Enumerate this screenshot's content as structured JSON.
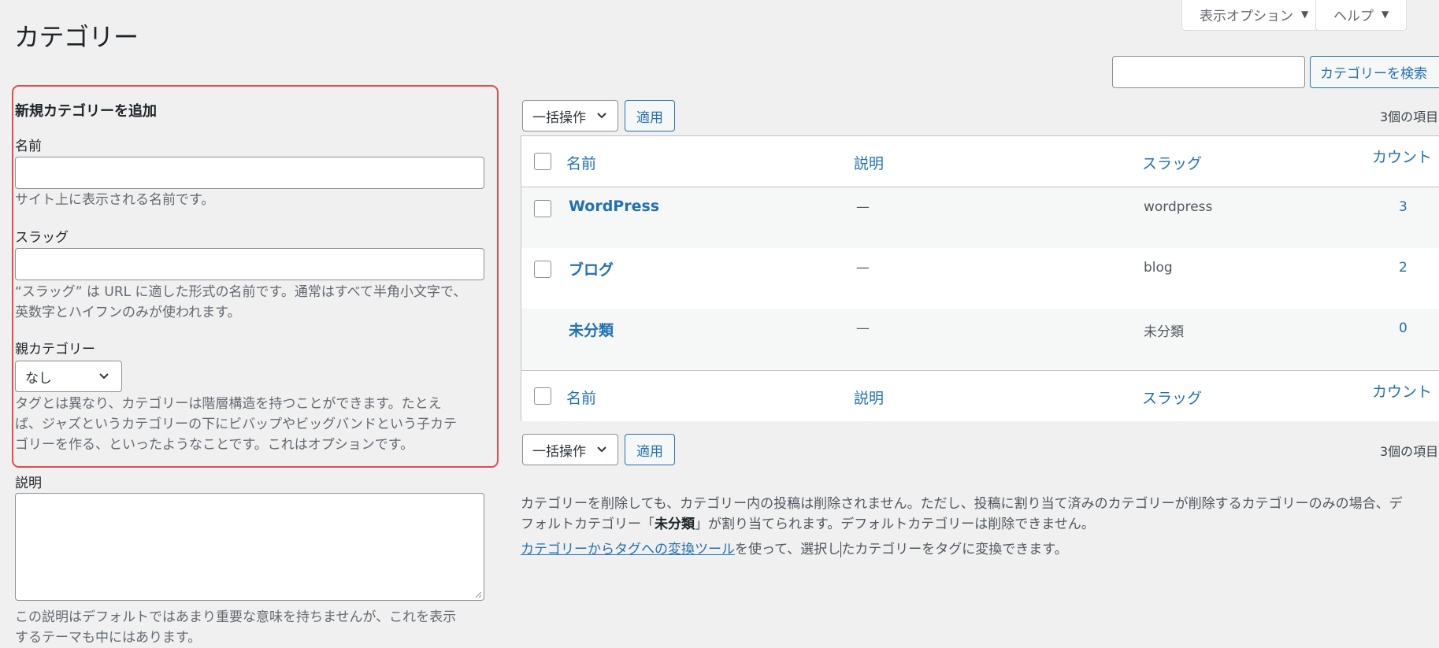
{
  "page": {
    "title": "カテゴリー"
  },
  "header": {
    "screen_options_label": "表示オプション",
    "help_label": "ヘルプ",
    "search_button_label": "カテゴリーを検索",
    "search_value": ""
  },
  "add_form": {
    "title": "新規カテゴリーを追加",
    "name_label": "名前",
    "name_value": "",
    "name_help": "サイト上に表示される名前です。",
    "slug_label": "スラッグ",
    "slug_value": "",
    "slug_help_line1": "“スラッグ” は URL に適した形式の名前です。通常はすべて半角小文字で、",
    "slug_help_line2": "英数字とハイフンのみが使われます。",
    "parent_label": "親カテゴリー",
    "parent_selected": "なし",
    "parent_help_line1": "タグとは異なり、カテゴリーは階層構造を持つことができます。たとえ",
    "parent_help_line2": "ば、ジャズというカテゴリーの下にビバップやビッグバンドという子カテ",
    "parent_help_line3": "ゴリーを作る、といったようなことです。これはオプションです。",
    "description_label": "説明",
    "description_value": "",
    "description_help_line1": "この説明はデフォルトではあまり重要な意味を持ちませんが、これを表示",
    "description_help_line2": "するテーマも中にはあります。"
  },
  "list": {
    "bulk_action_label": "一括操作",
    "apply_label": "適用",
    "item_count": "3個の項目",
    "columns": {
      "name": "名前",
      "description": "説明",
      "slug": "スラッグ",
      "count": "カウント"
    },
    "rows": [
      {
        "name": "WordPress",
        "description": "—",
        "slug": "wordpress",
        "count": "3"
      },
      {
        "name": "ブログ",
        "description": "—",
        "slug": "blog",
        "count": "2"
      },
      {
        "name": "未分類",
        "description": "—",
        "slug": "未分類",
        "count": "0"
      }
    ]
  },
  "notes": {
    "delete_note_line1": "カテゴリーを削除しても、カテゴリー内の投稿は削除されません。ただし、投稿に割り当て済みのカテゴリーが削除するカテゴリーのみの場合、デ",
    "delete_note_line2_pre": "フォルトカテゴリー「",
    "delete_note_line2_bold": "未分類",
    "delete_note_line2_post": "」が割り当てられます。デフォルトカテゴリーは削除できません。",
    "converter_link": "カテゴリーからタグへの変換ツール",
    "converter_text_a": "を使って、選択し",
    "converter_text_b": "たカテゴリーをタグに変換できます。"
  },
  "colors": {
    "accent": "#2271b1",
    "highlight_border": "#e34b4b",
    "background": "#f0f0f1"
  }
}
